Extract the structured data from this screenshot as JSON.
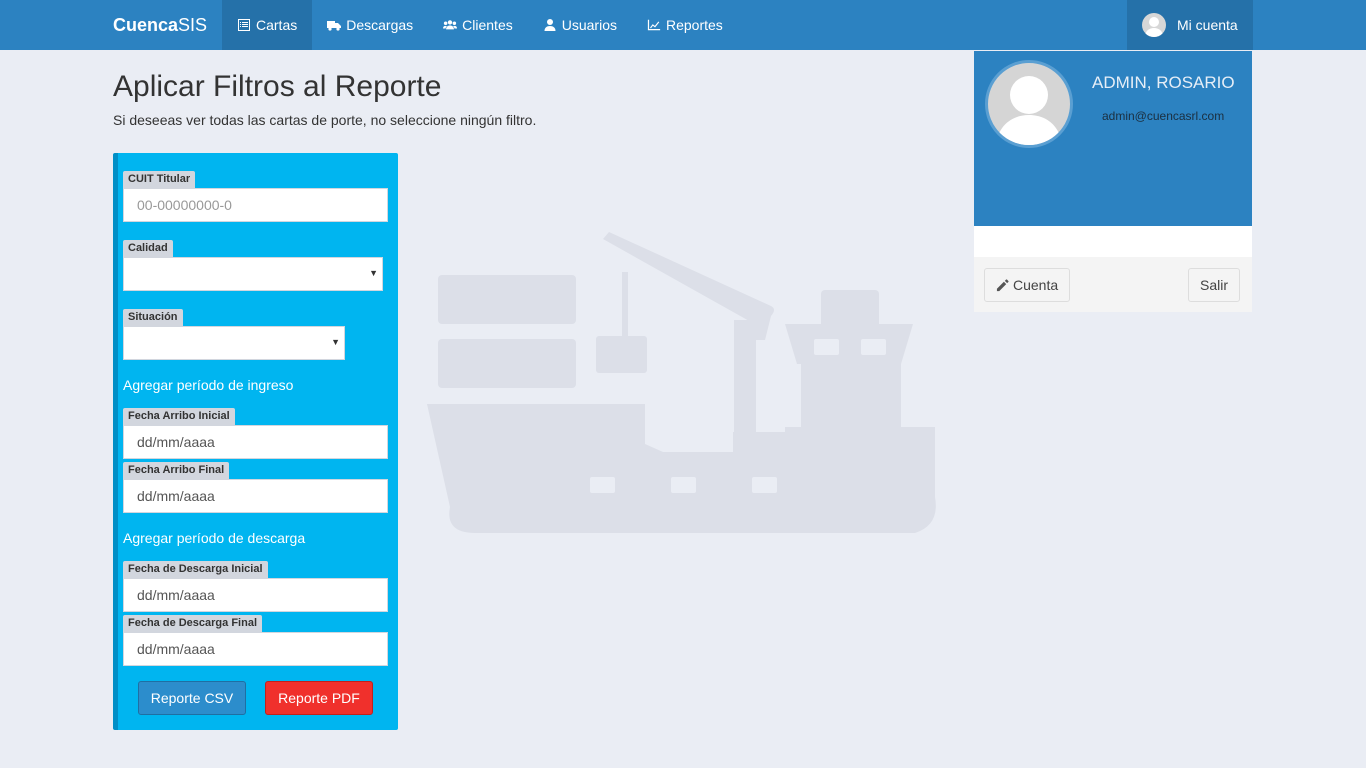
{
  "brand": {
    "bold": "Cuenca",
    "light": "SIS"
  },
  "nav": {
    "items": [
      {
        "label": "Cartas",
        "icon": "list-alt-icon"
      },
      {
        "label": "Descargas",
        "icon": "truck-icon"
      },
      {
        "label": "Clientes",
        "icon": "users-icon"
      },
      {
        "label": "Usuarios",
        "icon": "user-icon"
      },
      {
        "label": "Reportes",
        "icon": "line-chart-icon"
      }
    ],
    "account_label": "Mi cuenta"
  },
  "page": {
    "title": "Aplicar Filtros al Reporte",
    "subtitle": "Si deseeas ver todas las cartas de porte, no seleccione ningún filtro."
  },
  "form": {
    "cuit_label": "CUIT Titular",
    "cuit_placeholder": "00-00000000-0",
    "calidad_label": "Calidad",
    "situacion_label": "Situación",
    "ingreso_section": "Agregar período de ingreso",
    "arribo_inicial_label": "Fecha Arribo Inicial",
    "arribo_final_label": "Fecha Arribo Final",
    "descarga_section": "Agregar período de descarga",
    "descarga_inicial_label": "Fecha de Descarga Inicial",
    "descarga_final_label": "Fecha de Descarga Final",
    "date_placeholder": "dd/mm/aaaa",
    "csv_button": "Reporte CSV",
    "pdf_button": "Reporte PDF"
  },
  "user_card": {
    "name": "ADMIN, ROSARIO",
    "email": "admin@cuencasrl.com",
    "account_button": "Cuenta",
    "logout_button": "Salir"
  },
  "colors": {
    "navbar": "#2c82c1",
    "panel": "#00b5f0",
    "csv_button": "#2c8dcc",
    "pdf_button": "#f0302c"
  }
}
